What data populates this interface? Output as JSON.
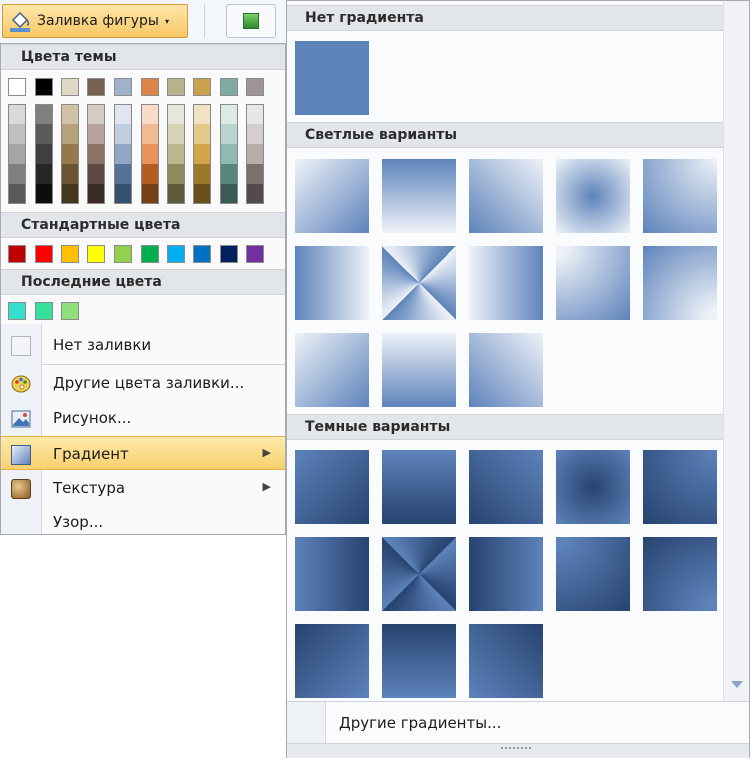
{
  "toolbar": {
    "fill_label": "Заливка фигуры"
  },
  "menu": {
    "theme_colors_header": "Цвета темы",
    "standard_colors_header": "Стандартные цвета",
    "recent_colors_header": "Последние цвета",
    "theme_colors": [
      "#ffffff",
      "#000000",
      "#e0d7c4",
      "#7a6253",
      "#9fb2c9",
      "#dd8548",
      "#b8b38f",
      "#c9a24e",
      "#7faaa4",
      "#9e9694"
    ],
    "theme_shades": [
      [
        "#d9d9d9",
        "#bfbfbf",
        "#a5a5a5",
        "#7f7f7f",
        "#595959"
      ],
      [
        "#7f7f7f",
        "#595959",
        "#404040",
        "#262626",
        "#0d0d0d"
      ],
      [
        "#cfc2a6",
        "#b5a27b",
        "#947a4a",
        "#6b5530",
        "#463620"
      ],
      [
        "#d6ccc6",
        "#b7a49a",
        "#8e7468",
        "#5d4a41",
        "#3a2d27"
      ],
      [
        "#dfe6ef",
        "#c1cfe0",
        "#8fa6c4",
        "#557399",
        "#33506f"
      ],
      [
        "#f8dcc9",
        "#f1ba93",
        "#e8935a",
        "#b35d22",
        "#773f17"
      ],
      [
        "#e8e6d9",
        "#d6d3b9",
        "#bdb790",
        "#8f8a5c",
        "#5e5a3c"
      ],
      [
        "#f0e3c3",
        "#e4c989",
        "#d2a54b",
        "#9d772a",
        "#694f1c"
      ],
      [
        "#dceae7",
        "#b9d5d0",
        "#8ebab3",
        "#56877f",
        "#395a55"
      ],
      [
        "#e9e6e5",
        "#d4cfcd",
        "#b5aeab",
        "#7a716e",
        "#524b49"
      ]
    ],
    "standard_colors": [
      "#c00000",
      "#ff0000",
      "#ffc000",
      "#ffff00",
      "#92d050",
      "#00b050",
      "#00b0f0",
      "#0070c0",
      "#002060",
      "#7030a0"
    ],
    "recent_colors": [
      "#33e0cc",
      "#35e09a",
      "#8fe07a"
    ],
    "items": [
      {
        "label": "Нет заливки"
      },
      {
        "label": "Другие цвета заливки..."
      },
      {
        "label": "Рисунок..."
      },
      {
        "label": "Градиент"
      },
      {
        "label": "Текстура"
      },
      {
        "label": "Узор..."
      }
    ]
  },
  "gallery": {
    "no_gradient_header": "Нет градиента",
    "light_header": "Светлые варианты",
    "dark_header": "Темные варианты",
    "base_color": "#5d83bb",
    "more_gradients": "Другие градиенты..."
  }
}
